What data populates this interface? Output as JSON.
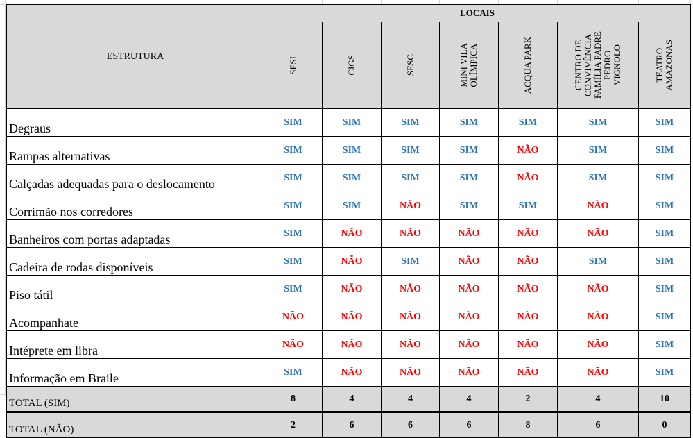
{
  "table": {
    "group_header": "LOCAIS",
    "row_header": "ESTRUTURA",
    "columns": [
      [
        "SESI"
      ],
      [
        "CIGS"
      ],
      [
        "SESC"
      ],
      [
        "MINI VILA",
        "OLÍMPICA"
      ],
      [
        "ACQUA PARK"
      ],
      [
        "CENTRO DE",
        "CONVIVÊNCIA",
        "FAMÍLIA PADRE",
        "PEDRO",
        "VIGNOLO"
      ],
      [
        "TEATRO",
        "AMAZONAS"
      ]
    ],
    "rows": [
      {
        "label": "Degraus",
        "values": [
          "SIM",
          "SIM",
          "SIM",
          "SIM",
          "SIM",
          "SIM",
          "SIM"
        ]
      },
      {
        "label": "Rampas alternativas",
        "values": [
          "SIM",
          "SIM",
          "SIM",
          "SIM",
          "NÃO",
          "SIM",
          "SIM"
        ]
      },
      {
        "label": "Calçadas adequadas para o deslocamento",
        "values": [
          "SIM",
          "SIM",
          "SIM",
          "SIM",
          "NÃO",
          "SIM",
          "SIM"
        ]
      },
      {
        "label": "Corrimão nos corredores",
        "values": [
          "SIM",
          "SIM",
          "NÃO",
          "SIM",
          "SIM",
          "NÃO",
          "SIM"
        ]
      },
      {
        "label": "Banheiros com portas adaptadas",
        "values": [
          "SIM",
          "NÃO",
          "NÃO",
          "NÃO",
          "NÃO",
          "NÃO",
          "SIM"
        ]
      },
      {
        "label": "Cadeira de rodas disponíveis",
        "values": [
          "SIM",
          "NÃO",
          "SIM",
          "NÃO",
          "NÃO",
          "SIM",
          "SIM"
        ]
      },
      {
        "label": "Piso tátil",
        "values": [
          "SIM",
          "NÃO",
          "NÃO",
          "NÃO",
          "NÃO",
          "NÃO",
          "SIM"
        ]
      },
      {
        "label": "Acompanhate",
        "values": [
          "NÃO",
          "NÃO",
          "NÃO",
          "NÃO",
          "NÃO",
          "NÃO",
          "SIM"
        ]
      },
      {
        "label": "Intéprete em libra",
        "values": [
          "NÃO",
          "NÃO",
          "NÃO",
          "NÃO",
          "NÃO",
          "NÃO",
          "SIM"
        ]
      },
      {
        "label": "Informação em Braile",
        "values": [
          "SIM",
          "NÃO",
          "NÃO",
          "NÃO",
          "NÃO",
          "NÃO",
          "SIM"
        ]
      }
    ],
    "totals": [
      {
        "label": "TOTAL (SIM)",
        "values": [
          "8",
          "4",
          "4",
          "4",
          "2",
          "4",
          "10"
        ]
      },
      {
        "label": "TOTAL (NÃO)",
        "values": [
          "2",
          "6",
          "6",
          "6",
          "8",
          "6",
          "0"
        ]
      }
    ],
    "colors": {
      "sim": "#2e75b6",
      "nao": "#ff0000",
      "header_bg": "#d9d9d9"
    }
  }
}
